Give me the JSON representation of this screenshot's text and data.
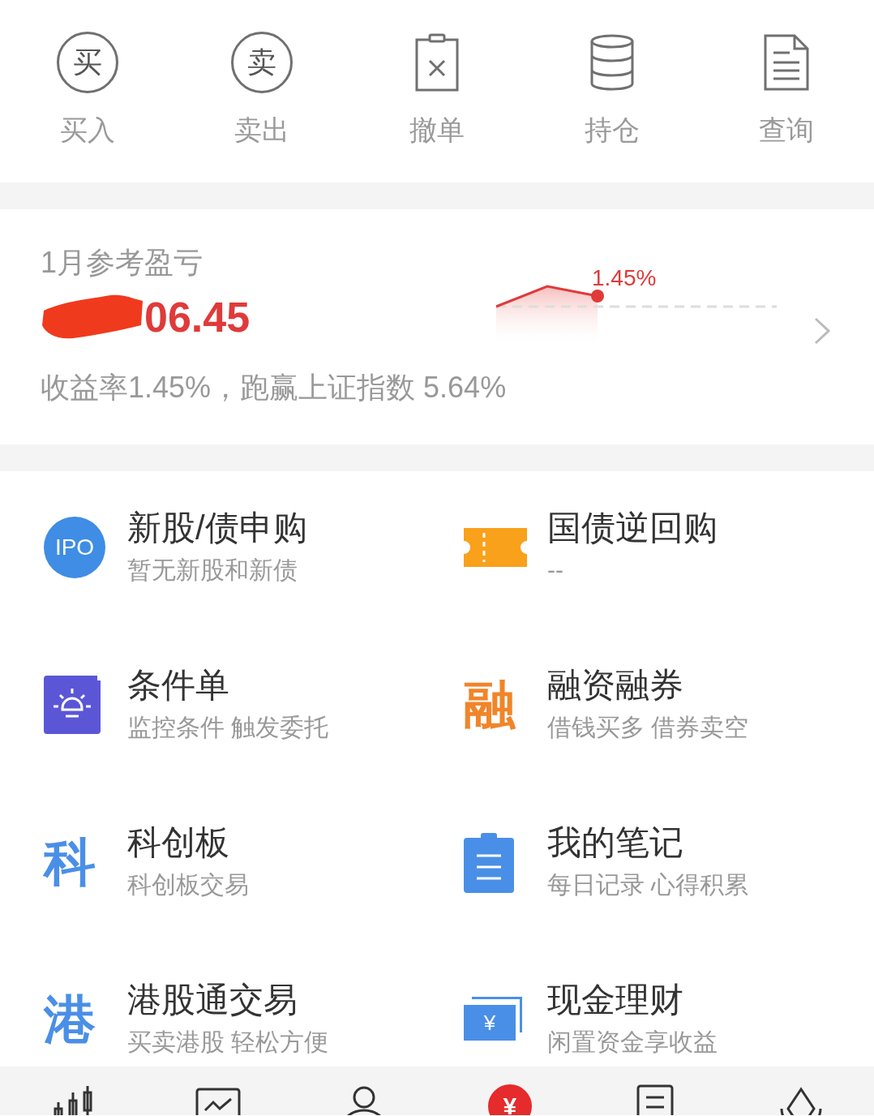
{
  "actions": [
    {
      "label": "买入",
      "icon": {
        "kind": "circle",
        "glyph": "买"
      }
    },
    {
      "label": "卖出",
      "icon": {
        "kind": "circle",
        "glyph": "卖"
      }
    },
    {
      "label": "撤单",
      "icon": {
        "kind": "clipboard"
      }
    },
    {
      "label": "持仓",
      "icon": {
        "kind": "database"
      }
    },
    {
      "label": "查询",
      "icon": {
        "kind": "document"
      }
    }
  ],
  "pnl": {
    "title": "1月参考盈亏",
    "amount": "06.45",
    "chart_label": "1.45%",
    "summary": "收益率1.45%，跑赢上证指数 5.64%"
  },
  "features": [
    {
      "title": "新股/债申购",
      "subtitle": "暂无新股和新债",
      "icon": {
        "kind": "ipo",
        "glyph": "IPO"
      }
    },
    {
      "title": "国债逆回购",
      "subtitle": "--",
      "icon": {
        "kind": "ticket"
      }
    },
    {
      "title": "条件单",
      "subtitle": "监控条件 触发委托",
      "icon": {
        "kind": "bulb"
      }
    },
    {
      "title": "融资融券",
      "subtitle": "借钱买多 借券卖空",
      "icon": {
        "kind": "char",
        "glyph": "融",
        "color": "#f0852a"
      }
    },
    {
      "title": "科创板",
      "subtitle": "科创板交易",
      "icon": {
        "kind": "char",
        "glyph": "科",
        "color": "#4a8fe7"
      }
    },
    {
      "title": "我的笔记",
      "subtitle": "每日记录 心得积累",
      "icon": {
        "kind": "notes"
      }
    },
    {
      "title": "港股通交易",
      "subtitle": "买卖港股 轻松方便",
      "icon": {
        "kind": "char",
        "glyph": "港",
        "color": "#4a8fe7"
      }
    },
    {
      "title": "现金理财",
      "subtitle": "闲置资金享收益",
      "icon": {
        "kind": "cash",
        "glyph": "¥"
      }
    }
  ],
  "nav": [
    {
      "kind": "candles",
      "selected": false
    },
    {
      "kind": "chart",
      "selected": false
    },
    {
      "kind": "person",
      "selected": false
    },
    {
      "kind": "yen",
      "glyph": "¥",
      "selected": true
    },
    {
      "kind": "list",
      "selected": false
    },
    {
      "kind": "diamond",
      "selected": false
    }
  ]
}
